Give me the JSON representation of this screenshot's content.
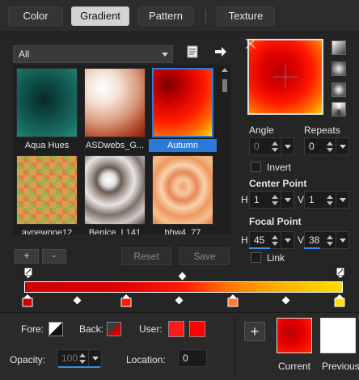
{
  "tabs": [
    {
      "label": "Color"
    },
    {
      "label": "Gradient"
    },
    {
      "label": "Pattern"
    },
    {
      "label": "Texture"
    }
  ],
  "category": {
    "selected": "All"
  },
  "gallery": {
    "items": [
      {
        "name": "Aqua Hues"
      },
      {
        "name": "ASDwebs_G..."
      },
      {
        "name": "Autumn"
      },
      {
        "name": "aynewone12"
      },
      {
        "name": "Benice_L141"
      },
      {
        "name": "bhw4_77"
      }
    ],
    "selected": "Autumn"
  },
  "buttons": {
    "add": "+",
    "remove": "-",
    "reset": "Reset",
    "save": "Save"
  },
  "params": {
    "angle": {
      "label": "Angle",
      "value": "0"
    },
    "repeats": {
      "label": "Repeats",
      "value": "0"
    },
    "invert": {
      "label": "Invert"
    },
    "center_point": {
      "label": "Center Point",
      "h_label": "H",
      "h": "1",
      "v_label": "V",
      "v": "1"
    },
    "focal_point": {
      "label": "Focal Point",
      "h_label": "H",
      "h": "45",
      "v_label": "V",
      "v": "38"
    },
    "link": {
      "label": "Link"
    }
  },
  "bottom": {
    "fore_label": "Fore:",
    "back_label": "Back:",
    "user_label": "User:",
    "opacity_label": "Opacity:",
    "opacity_value": "100",
    "location_label": "Location:",
    "location_value": "0",
    "add_label": "+",
    "current_label": "Current",
    "previous_label": "Previous"
  },
  "colors": {
    "selection": "#2b7ad9",
    "user1": "#ff1a1a",
    "user2": "#ff0000",
    "current_start": "#ff0000",
    "current_end": "#cc0000",
    "previous": "#ffffff"
  },
  "icons": [
    "document-icon",
    "arrow-right-icon"
  ]
}
